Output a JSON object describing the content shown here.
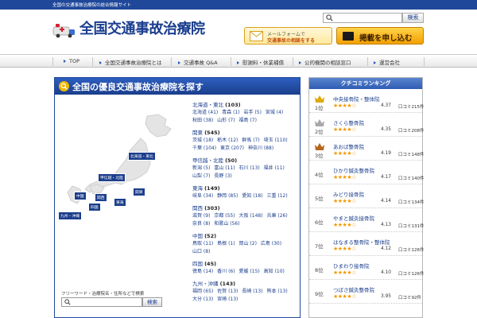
{
  "topbar": {
    "tagline": "全国の交通事故治療院の総合情報サイト"
  },
  "header": {
    "title": "全国交通事故治療院",
    "search_placeholder": "",
    "search_button": "検索"
  },
  "cta": {
    "mail_line1": "メールフォームで",
    "mail_line2": "交通事故の相談をする",
    "apply": "掲載を申し込む"
  },
  "nav": {
    "items": [
      "TOP",
      "全国交通事故治療院とは",
      "交通事故 Q&A",
      "慰謝料・休業補償",
      "公的機関の相談窓口",
      "運営会社"
    ]
  },
  "search_panel": {
    "title": "全国の優良交通事故治療院を探す",
    "regions": [
      "北海道・東北",
      "甲信越・北陸",
      "関東",
      "中国",
      "関西",
      "東海",
      "四国",
      "九州・沖縄"
    ],
    "groups": [
      {
        "name": "北海道・東北",
        "count": "(103)",
        "prefs": [
          "北海道 (41)",
          "青森 (1)",
          "岩手 (5)",
          "宮城 (4)",
          "秋田 (38)",
          "山形 (7)",
          "福島 (7)"
        ]
      },
      {
        "name": "関東",
        "count": "(545)",
        "prefs": [
          "茨城 (18)",
          "栃木 (12)",
          "群馬 (7)",
          "埼玉 (110)",
          "千葉 (104)",
          "東京 (207)",
          "神奈川 (88)"
        ]
      },
      {
        "name": "甲信越・北陸",
        "count": "(50)",
        "prefs": [
          "新潟 (5)",
          "富山 (11)",
          "石川 (13)",
          "福井 (11)",
          "山梨 (7)",
          "長野 (3)"
        ]
      },
      {
        "name": "東海",
        "count": "(149)",
        "prefs": [
          "岐阜 (34)",
          "静岡 (85)",
          "愛知 (18)",
          "三重 (12)"
        ]
      },
      {
        "name": "関西",
        "count": "(303)",
        "prefs": [
          "滋賀 (9)",
          "京都 (55)",
          "大阪 (148)",
          "兵庫 (26)",
          "奈良 (8)",
          "和歌山 (56)"
        ]
      },
      {
        "name": "中国",
        "count": "(52)",
        "prefs": [
          "鳥取 (11)",
          "島根 (1)",
          "岡山 (2)",
          "広島 (30)",
          "山口 (8)"
        ]
      },
      {
        "name": "四国",
        "count": "(45)",
        "prefs": [
          "徳島 (14)",
          "香川 (6)",
          "愛媛 (15)",
          "高知 (10)"
        ]
      },
      {
        "name": "九州・沖縄",
        "count": "(143)",
        "prefs": [
          "福岡 (65)",
          "佐賀 (13)",
          "長崎 (13)",
          "熊本 (13)",
          "大分 (13)",
          "宮崎 (13)"
        ]
      }
    ],
    "free_label": "フリーワード・治療院名・住所などで検索",
    "free_button": "検索"
  },
  "ranking": {
    "title": "クチコミランキング",
    "items": [
      {
        "rank": "1位",
        "name": "中央接骨院・整体院",
        "stars": "★★★★☆",
        "score": "4.37",
        "count": "口コミ215件"
      },
      {
        "rank": "2位",
        "name": "さくら整骨院",
        "stars": "★★★★☆",
        "score": "4.35",
        "count": "口コミ208件"
      },
      {
        "rank": "3位",
        "name": "あおば整骨院",
        "stars": "★★★★☆",
        "score": "4.19",
        "count": "口コミ148件"
      },
      {
        "rank": "4位",
        "name": "ひかり鍼灸整骨院",
        "stars": "★★★★☆",
        "score": "4.17",
        "count": "口コミ140件"
      },
      {
        "rank": "5位",
        "name": "みどり接骨院",
        "stars": "★★★★☆",
        "score": "4.14",
        "count": "口コミ134件"
      },
      {
        "rank": "6位",
        "name": "やまと鍼灸接骨院",
        "stars": "★★★★☆",
        "score": "4.13",
        "count": "口コミ131件"
      },
      {
        "rank": "7位",
        "name": "はなまる整骨院・整体院",
        "stars": "★★★★☆",
        "score": "4.12",
        "count": "口コミ126件"
      },
      {
        "rank": "8位",
        "name": "ひまわり接骨院",
        "stars": "★★★★☆",
        "score": "4.10",
        "count": "口コミ126件"
      },
      {
        "rank": "9位",
        "name": "つばさ鍼灸整骨院",
        "stars": "★★★★☆",
        "score": "3.95",
        "count": "口コミ92件"
      }
    ]
  },
  "colors": {
    "brand": "#1b3e8c",
    "accent": "#f1b600",
    "star": "#f39800"
  }
}
